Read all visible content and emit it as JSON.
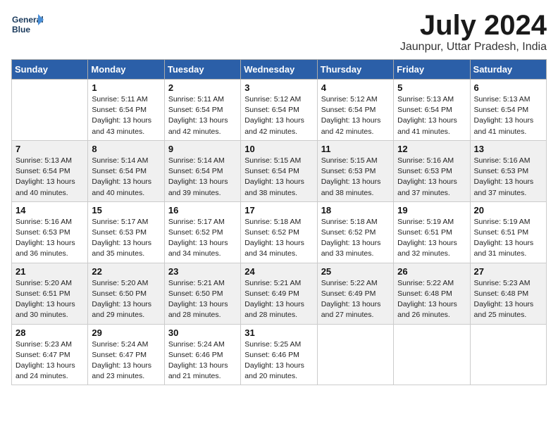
{
  "header": {
    "logo_line1": "General",
    "logo_line2": "Blue",
    "month": "July 2024",
    "location": "Jaunpur, Uttar Pradesh, India"
  },
  "weekdays": [
    "Sunday",
    "Monday",
    "Tuesday",
    "Wednesday",
    "Thursday",
    "Friday",
    "Saturday"
  ],
  "weeks": [
    [
      {
        "day": "",
        "sunrise": "",
        "sunset": "",
        "daylight": ""
      },
      {
        "day": "1",
        "sunrise": "Sunrise: 5:11 AM",
        "sunset": "Sunset: 6:54 PM",
        "daylight": "Daylight: 13 hours and 43 minutes."
      },
      {
        "day": "2",
        "sunrise": "Sunrise: 5:11 AM",
        "sunset": "Sunset: 6:54 PM",
        "daylight": "Daylight: 13 hours and 42 minutes."
      },
      {
        "day": "3",
        "sunrise": "Sunrise: 5:12 AM",
        "sunset": "Sunset: 6:54 PM",
        "daylight": "Daylight: 13 hours and 42 minutes."
      },
      {
        "day": "4",
        "sunrise": "Sunrise: 5:12 AM",
        "sunset": "Sunset: 6:54 PM",
        "daylight": "Daylight: 13 hours and 42 minutes."
      },
      {
        "day": "5",
        "sunrise": "Sunrise: 5:13 AM",
        "sunset": "Sunset: 6:54 PM",
        "daylight": "Daylight: 13 hours and 41 minutes."
      },
      {
        "day": "6",
        "sunrise": "Sunrise: 5:13 AM",
        "sunset": "Sunset: 6:54 PM",
        "daylight": "Daylight: 13 hours and 41 minutes."
      }
    ],
    [
      {
        "day": "7",
        "sunrise": "Sunrise: 5:13 AM",
        "sunset": "Sunset: 6:54 PM",
        "daylight": "Daylight: 13 hours and 40 minutes."
      },
      {
        "day": "8",
        "sunrise": "Sunrise: 5:14 AM",
        "sunset": "Sunset: 6:54 PM",
        "daylight": "Daylight: 13 hours and 40 minutes."
      },
      {
        "day": "9",
        "sunrise": "Sunrise: 5:14 AM",
        "sunset": "Sunset: 6:54 PM",
        "daylight": "Daylight: 13 hours and 39 minutes."
      },
      {
        "day": "10",
        "sunrise": "Sunrise: 5:15 AM",
        "sunset": "Sunset: 6:54 PM",
        "daylight": "Daylight: 13 hours and 38 minutes."
      },
      {
        "day": "11",
        "sunrise": "Sunrise: 5:15 AM",
        "sunset": "Sunset: 6:53 PM",
        "daylight": "Daylight: 13 hours and 38 minutes."
      },
      {
        "day": "12",
        "sunrise": "Sunrise: 5:16 AM",
        "sunset": "Sunset: 6:53 PM",
        "daylight": "Daylight: 13 hours and 37 minutes."
      },
      {
        "day": "13",
        "sunrise": "Sunrise: 5:16 AM",
        "sunset": "Sunset: 6:53 PM",
        "daylight": "Daylight: 13 hours and 37 minutes."
      }
    ],
    [
      {
        "day": "14",
        "sunrise": "Sunrise: 5:16 AM",
        "sunset": "Sunset: 6:53 PM",
        "daylight": "Daylight: 13 hours and 36 minutes."
      },
      {
        "day": "15",
        "sunrise": "Sunrise: 5:17 AM",
        "sunset": "Sunset: 6:53 PM",
        "daylight": "Daylight: 13 hours and 35 minutes."
      },
      {
        "day": "16",
        "sunrise": "Sunrise: 5:17 AM",
        "sunset": "Sunset: 6:52 PM",
        "daylight": "Daylight: 13 hours and 34 minutes."
      },
      {
        "day": "17",
        "sunrise": "Sunrise: 5:18 AM",
        "sunset": "Sunset: 6:52 PM",
        "daylight": "Daylight: 13 hours and 34 minutes."
      },
      {
        "day": "18",
        "sunrise": "Sunrise: 5:18 AM",
        "sunset": "Sunset: 6:52 PM",
        "daylight": "Daylight: 13 hours and 33 minutes."
      },
      {
        "day": "19",
        "sunrise": "Sunrise: 5:19 AM",
        "sunset": "Sunset: 6:51 PM",
        "daylight": "Daylight: 13 hours and 32 minutes."
      },
      {
        "day": "20",
        "sunrise": "Sunrise: 5:19 AM",
        "sunset": "Sunset: 6:51 PM",
        "daylight": "Daylight: 13 hours and 31 minutes."
      }
    ],
    [
      {
        "day": "21",
        "sunrise": "Sunrise: 5:20 AM",
        "sunset": "Sunset: 6:51 PM",
        "daylight": "Daylight: 13 hours and 30 minutes."
      },
      {
        "day": "22",
        "sunrise": "Sunrise: 5:20 AM",
        "sunset": "Sunset: 6:50 PM",
        "daylight": "Daylight: 13 hours and 29 minutes."
      },
      {
        "day": "23",
        "sunrise": "Sunrise: 5:21 AM",
        "sunset": "Sunset: 6:50 PM",
        "daylight": "Daylight: 13 hours and 28 minutes."
      },
      {
        "day": "24",
        "sunrise": "Sunrise: 5:21 AM",
        "sunset": "Sunset: 6:49 PM",
        "daylight": "Daylight: 13 hours and 28 minutes."
      },
      {
        "day": "25",
        "sunrise": "Sunrise: 5:22 AM",
        "sunset": "Sunset: 6:49 PM",
        "daylight": "Daylight: 13 hours and 27 minutes."
      },
      {
        "day": "26",
        "sunrise": "Sunrise: 5:22 AM",
        "sunset": "Sunset: 6:48 PM",
        "daylight": "Daylight: 13 hours and 26 minutes."
      },
      {
        "day": "27",
        "sunrise": "Sunrise: 5:23 AM",
        "sunset": "Sunset: 6:48 PM",
        "daylight": "Daylight: 13 hours and 25 minutes."
      }
    ],
    [
      {
        "day": "28",
        "sunrise": "Sunrise: 5:23 AM",
        "sunset": "Sunset: 6:47 PM",
        "daylight": "Daylight: 13 hours and 24 minutes."
      },
      {
        "day": "29",
        "sunrise": "Sunrise: 5:24 AM",
        "sunset": "Sunset: 6:47 PM",
        "daylight": "Daylight: 13 hours and 23 minutes."
      },
      {
        "day": "30",
        "sunrise": "Sunrise: 5:24 AM",
        "sunset": "Sunset: 6:46 PM",
        "daylight": "Daylight: 13 hours and 21 minutes."
      },
      {
        "day": "31",
        "sunrise": "Sunrise: 5:25 AM",
        "sunset": "Sunset: 6:46 PM",
        "daylight": "Daylight: 13 hours and 20 minutes."
      },
      {
        "day": "",
        "sunrise": "",
        "sunset": "",
        "daylight": ""
      },
      {
        "day": "",
        "sunrise": "",
        "sunset": "",
        "daylight": ""
      },
      {
        "day": "",
        "sunrise": "",
        "sunset": "",
        "daylight": ""
      }
    ]
  ]
}
